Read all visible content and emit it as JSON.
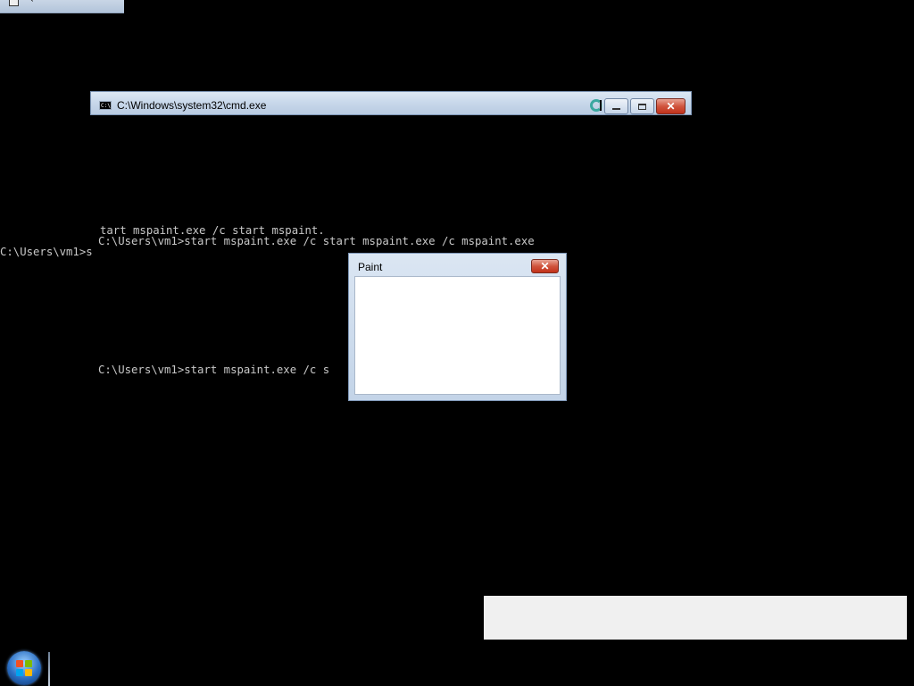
{
  "cmd_window": {
    "title": "C:\\Windows\\system32\\cmd.exe",
    "icon_text": "C:\\",
    "minimize_label": "",
    "maximize_label": "",
    "close_label": "✕"
  },
  "console": {
    "lines": [
      "tart mspaint.exe /c start mspaint.",
      "C:\\Users\\vm1>start mspaint.exe /c start mspaint.exe /c mspaint.exe",
      "C:\\Users\\vm1>s",
      "C:\\Users\\vm1>start mspaint.exe /c s"
    ]
  },
  "paint_dialog": {
    "title": "Paint",
    "close_label": "✕"
  },
  "icons": {
    "console_app": "console-app-icon",
    "start": "windows-start-orb-icon",
    "busy_cursor": "busy-cursor-icon"
  },
  "colors": {
    "desktop": "#000000",
    "console_text": "#c8c8c8",
    "titlebar": "#c7d7ea",
    "close_button": "#c2321b"
  }
}
